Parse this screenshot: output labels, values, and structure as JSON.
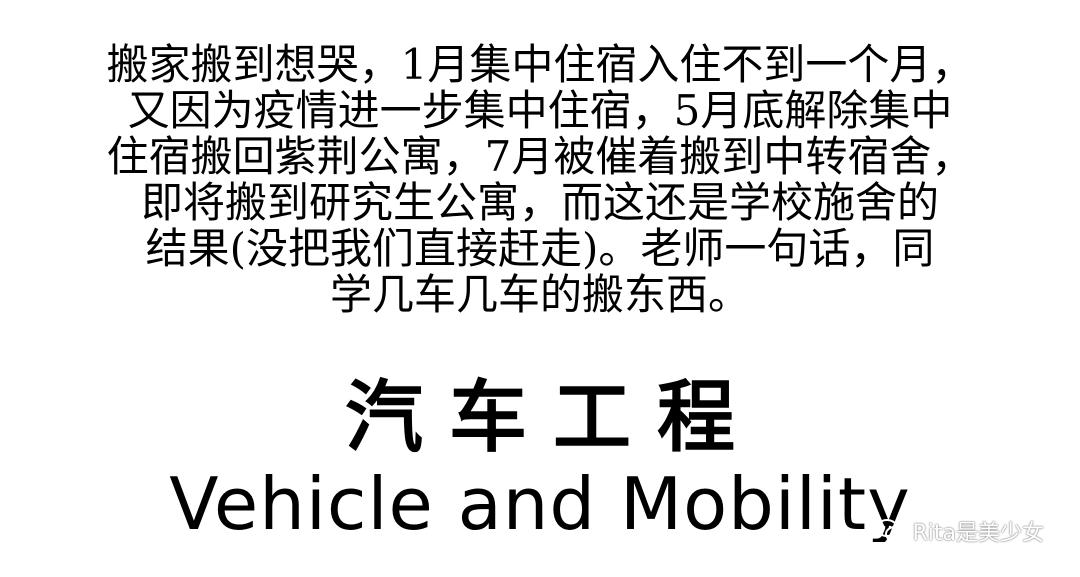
{
  "paragraph": {
    "lines": [
      "搬家搬到想哭，1月集中住宿入住不到一个月，",
      "又因为疫情进一步集中住宿，5月底解除集中",
      "住宿搬回紫荆公寓，7月被催着搬到中转宿舍，",
      "即将搬到研究生公寓，而这还是学校施舍的",
      "结果(没把我们直接赶走)。老师一句话，同",
      "学几车几车的搬东西。"
    ]
  },
  "heading": {
    "chinese": "汽车工程",
    "english": "Vehicle and Mobility"
  },
  "watermark": {
    "icon": "wechat-icon",
    "text": "Rita是美少女"
  }
}
